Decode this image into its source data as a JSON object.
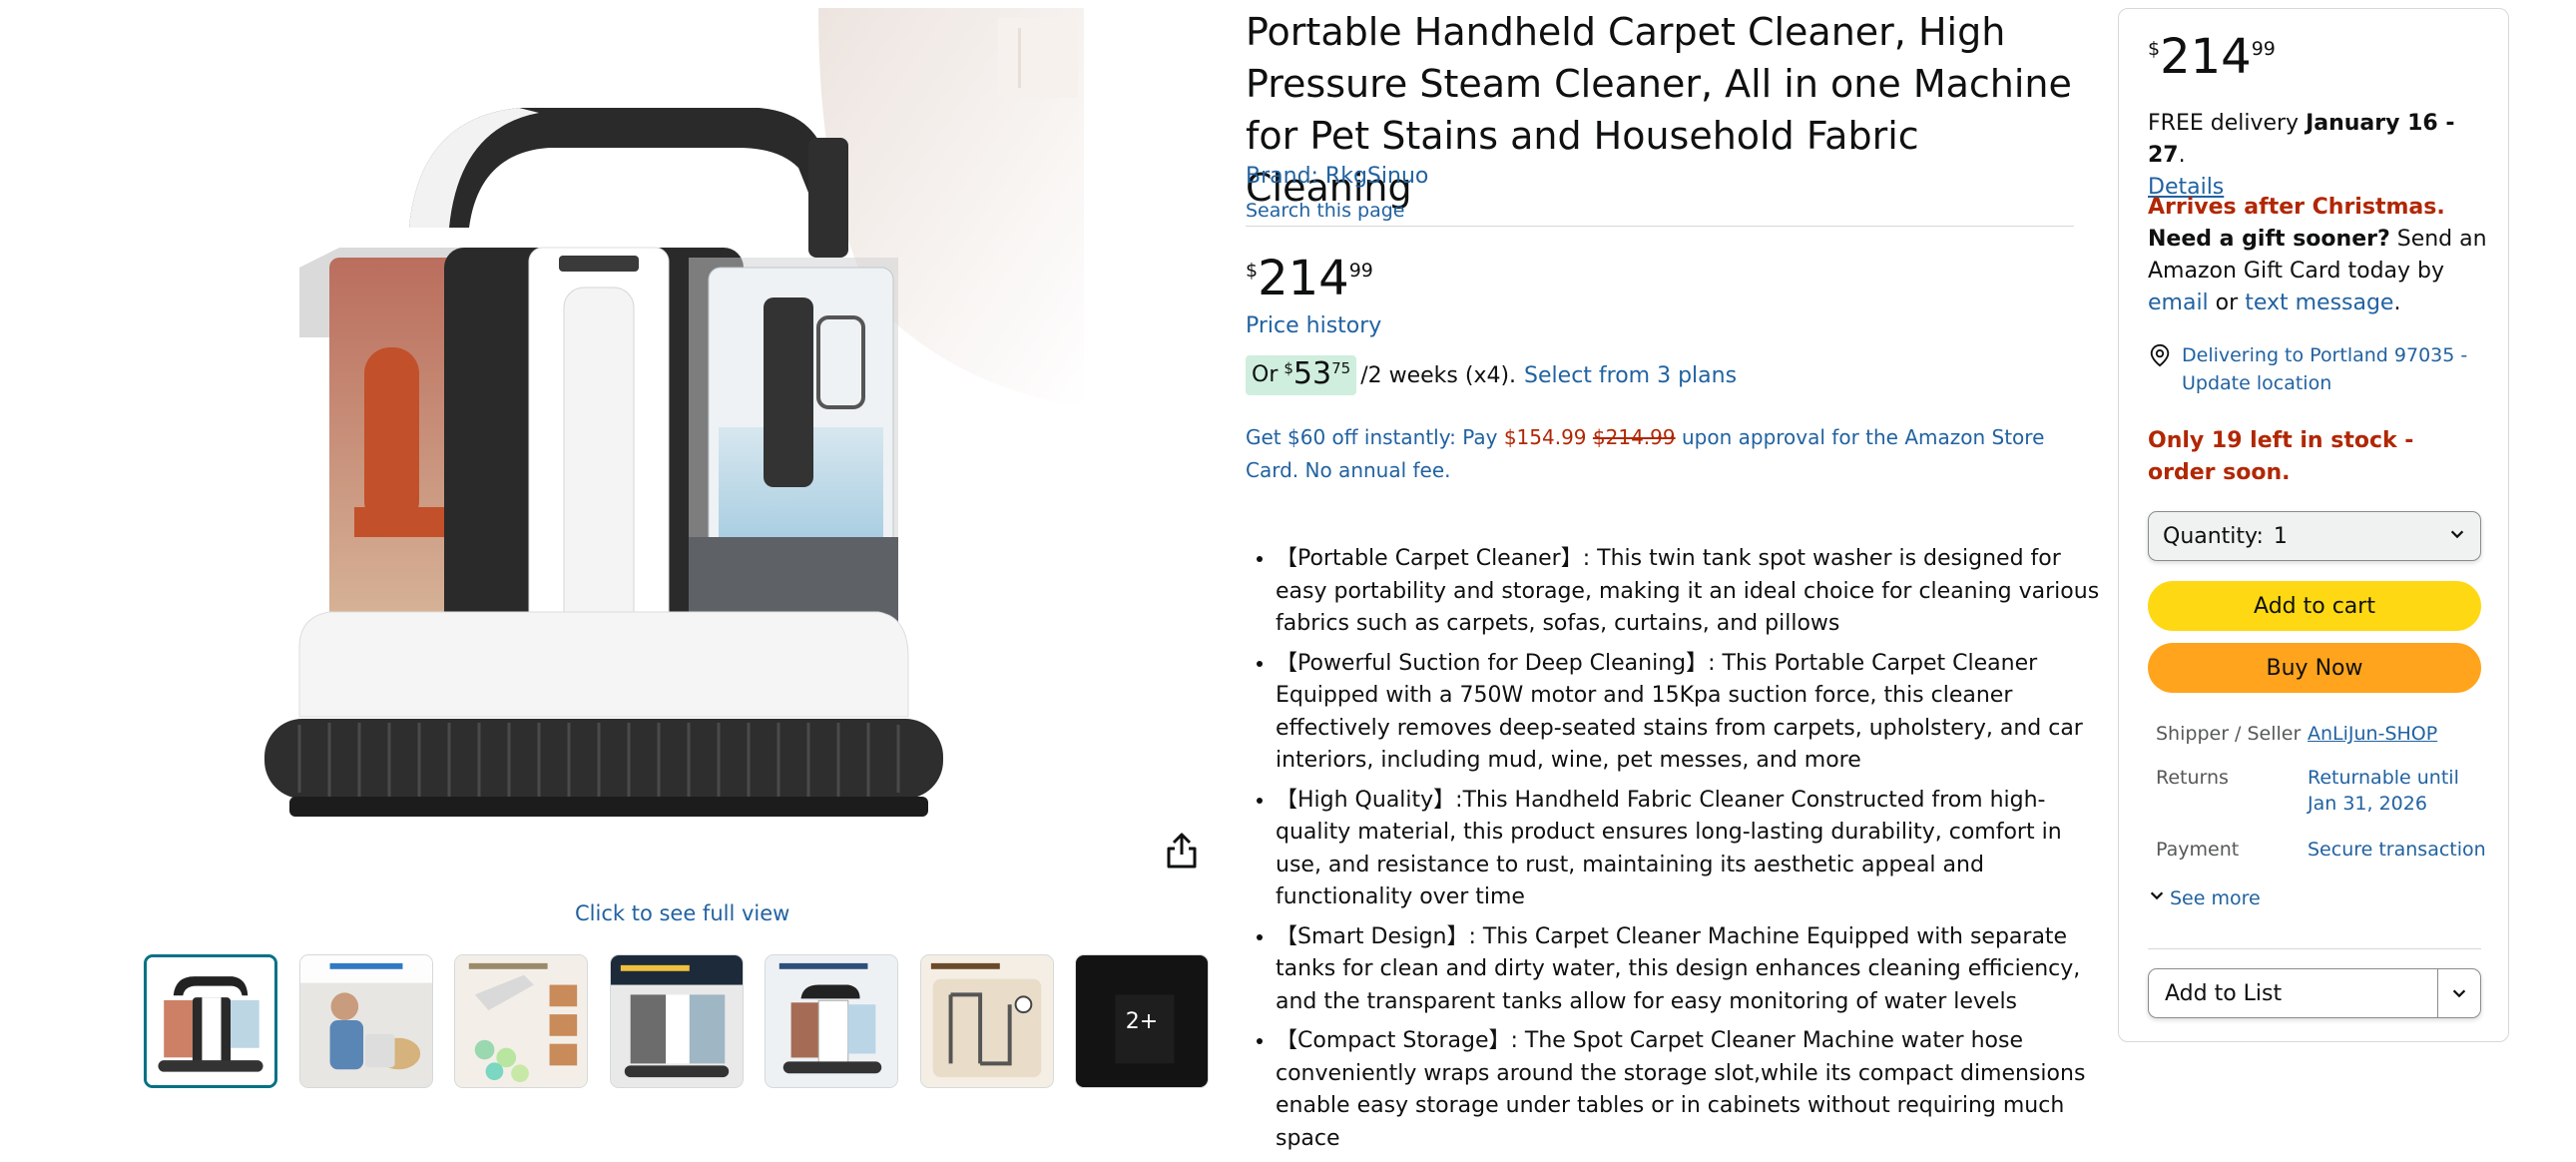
{
  "gallery": {
    "main_image_alt": "Portable carpet cleaner product photo",
    "click_full_view": "Click to see full view",
    "more_count": "2+",
    "thumbnails": [
      "thumbnail-1",
      "thumbnail-2",
      "thumbnail-3",
      "thumbnail-4",
      "thumbnail-5",
      "thumbnail-6",
      "thumbnail-7"
    ]
  },
  "product": {
    "title": "Portable Handheld Carpet Cleaner, High Pressure Steam Cleaner, All in one Machine for Pet Stains and Household Fabric Cleaning",
    "brand": "Brand: RkgSinuo",
    "search_page": "Search this page",
    "price": {
      "symbol": "$",
      "whole": "214",
      "fraction": "99"
    },
    "price_history": "Price history",
    "installment": {
      "or": "Or",
      "symbol": "$",
      "whole": "53",
      "fraction": "75",
      "term": "/2 weeks (x4).",
      "link": "Select from 3 plans"
    },
    "card_offer": {
      "prefix": "Get $60 off instantly: Pay",
      "new_price": "$154.99",
      "old_price": "$214.99",
      "suffix": "upon approval for the Amazon Store Card. No annual fee."
    },
    "bullets": [
      "【Portable Carpet Cleaner】: This twin tank spot washer is designed for easy portability and storage, making it an ideal choice for cleaning various fabrics such as carpets, sofas, curtains, and pillows",
      "【Powerful Suction for Deep Cleaning】: This Portable Carpet Cleaner Equipped with a 750W motor and 15Kpa suction force, this cleaner effectively removes deep-seated stains from carpets, upholstery, and car interiors, including mud, wine, pet messes, and more",
      "【High Quality】:This Handheld Fabric Cleaner Constructed from high-quality material, this product ensures long-lasting durability, comfort in use, and resistance to rust, maintaining its aesthetic appeal and functionality over time",
      "【Smart Design】: This Carpet Cleaner Machine Equipped with separate tanks for clean and dirty water, this design enhances cleaning efficiency, and the transparent tanks allow for easy monitoring of water levels",
      "【Compact Storage】: The Spot Carpet Cleaner Machine water hose conveniently wraps around the storage slot,while its compact dimensions enable easy storage under tables or in cabinets without requiring much space"
    ]
  },
  "buybox": {
    "price": {
      "symbol": "$",
      "whole": "214",
      "fraction": "99"
    },
    "delivery_prefix": "FREE delivery",
    "delivery_dates": "January 16 - 27",
    "delivery_suffix": ".",
    "details_link": "Details",
    "christmas_red": "Arrives after Christmas.",
    "christmas_bold": "Need a gift sooner?",
    "christmas_text": "Send an Amazon Gift Card today by",
    "email_link": "email",
    "or_text": "or",
    "text_link": "text message",
    "period": ".",
    "location": "Delivering to Portland 97035 - Update location",
    "stock": "Only 19 left in stock - order soon.",
    "quantity_label": "Quantity:",
    "quantity_value": "1",
    "add_to_cart": "Add to cart",
    "buy_now": "Buy Now",
    "shipper_key": "Shipper / Seller",
    "shipper_value": "AnLiJun-SHOP",
    "returns_key": "Returns",
    "returns_value": "Returnable until Jan 31, 2026",
    "payment_key": "Payment",
    "payment_value": "Secure transaction",
    "see_more": "See more",
    "add_to_list": "Add to List"
  },
  "colors": {
    "link": "#2162a1",
    "price_red": "#b12704",
    "cart_yellow": "#ffd814",
    "buy_orange": "#ffa41c",
    "thumb_selected": "#007185"
  }
}
